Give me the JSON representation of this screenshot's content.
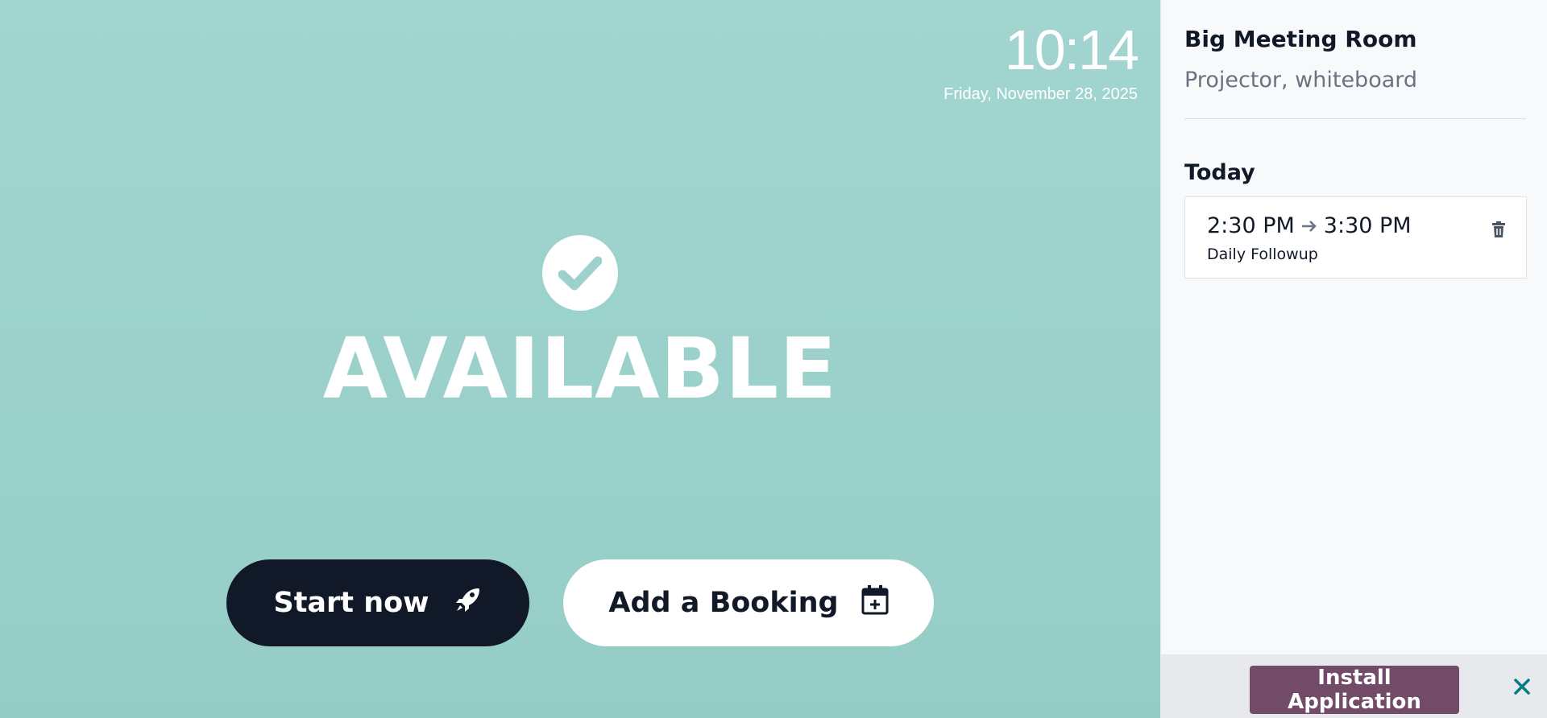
{
  "clock": {
    "time": "10:14",
    "date": "Friday, November 28, 2025"
  },
  "status": {
    "label": "AVAILABLE",
    "icon": "check-circle-icon"
  },
  "actions": {
    "start_label": "Start now",
    "start_icon": "rocket-icon",
    "book_label": "Add a Booking",
    "book_icon": "calendar-plus-icon"
  },
  "room": {
    "name": "Big Meeting Room",
    "description": "Projector, whiteboard"
  },
  "schedule": {
    "heading": "Today",
    "bookings": [
      {
        "start": "2:30 PM",
        "end": "3:30 PM",
        "title": "Daily Followup",
        "delete_icon": "trash-icon"
      }
    ]
  },
  "install": {
    "label": "Install Application",
    "close_icon": "close-icon"
  },
  "colors": {
    "background": "#9dd1cb",
    "start_button": "#111827",
    "install_button": "#714b67",
    "close_icon": "#017e84"
  }
}
